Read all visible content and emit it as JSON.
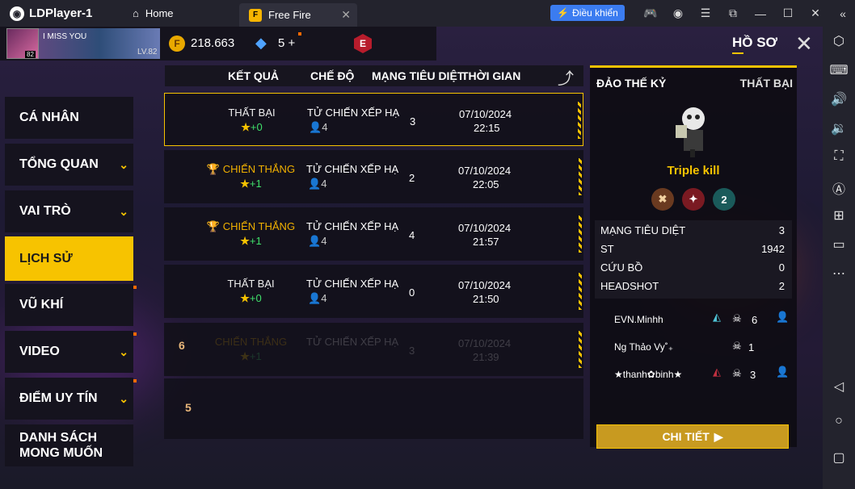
{
  "emulator": {
    "app_title": "LDPlayer-1",
    "tabs": [
      {
        "label": "Home",
        "icon": "home-icon"
      },
      {
        "label": "Free Fire",
        "icon": "freefire-icon"
      }
    ],
    "control_button": "Điều khiển",
    "accent": "#3b7cf0"
  },
  "player": {
    "name": "I MISS YOU",
    "level": "LV.82",
    "avatar_level": "82",
    "coins": "218.663",
    "diamonds": "5",
    "diamond_plus": "+",
    "rank_badge": "E"
  },
  "header": {
    "title": "HỒ SƠ"
  },
  "nav": [
    {
      "label": "CÁ NHÂN",
      "chevron": false
    },
    {
      "label": "TỔNG QUAN",
      "chevron": true
    },
    {
      "label": "VAI TRÒ",
      "chevron": true
    },
    {
      "label": "LỊCH SỬ",
      "chevron": false,
      "active": true
    },
    {
      "label": "VŨ KHÍ",
      "chevron": false
    },
    {
      "label": "VIDEO",
      "chevron": true
    },
    {
      "label": "ĐIỂM UY TÍN",
      "chevron": true
    },
    {
      "label": "DANH SÁCH",
      "label2": "MONG MUỐN",
      "chevron": false
    }
  ],
  "table": {
    "headers": [
      "KẾT QUẢ",
      "CHẾ ĐỘ",
      "MẠNG TIÊU DIỆT",
      "THỜI GIAN"
    ],
    "rows": [
      {
        "result": "THẤT BẠI",
        "win": false,
        "stars": "+0",
        "mode": "TỬ CHIẾN XẾP HẠ",
        "team": "4",
        "kills": "3",
        "date": "07/10/2024",
        "time": "22:15"
      },
      {
        "result": "CHIẾN THẮNG",
        "win": true,
        "stars": "+1",
        "mode": "TỬ CHIẾN XẾP HẠ",
        "team": "4",
        "kills": "2",
        "date": "07/10/2024",
        "time": "22:05"
      },
      {
        "result": "CHIẾN THẮNG",
        "win": true,
        "stars": "+1",
        "mode": "TỬ CHIẾN XẾP HẠ",
        "team": "4",
        "kills": "4",
        "date": "07/10/2024",
        "time": "21:57"
      },
      {
        "result": "THẤT BẠI",
        "win": false,
        "stars": "+0",
        "mode": "TỬ CHIẾN XẾP HẠ",
        "team": "4",
        "kills": "0",
        "date": "07/10/2024",
        "time": "21:50"
      },
      {
        "result": "CHIẾN THẮNG",
        "win": true,
        "stars": "+1",
        "mode": "TỬ CHIẾN XẾP HẠ",
        "team": "4",
        "kills": "3",
        "date": "07/10/2024",
        "time": "21:39",
        "badge": "6",
        "faded": true
      }
    ],
    "extra_badge": "5"
  },
  "detail": {
    "map": "ĐẢO THẾ KỶ",
    "outcome": "THẤT BẠI",
    "achievement": "Triple kill",
    "medal_number": "2",
    "stats": [
      {
        "label": "MẠNG TIÊU DIỆT",
        "value": "3"
      },
      {
        "label": "ST",
        "value": "1942"
      },
      {
        "label": "CỨU BỒ",
        "value": "0"
      },
      {
        "label": "HEADSHOT",
        "value": "2"
      }
    ],
    "players": [
      {
        "name": "EVN.Minhh",
        "kills": "6"
      },
      {
        "name": "Ng Thảo Vy˚₊",
        "kills": "1"
      },
      {
        "name": "★thanh✿binh★",
        "kills": "3"
      }
    ],
    "button": "CHI TIẾT"
  }
}
